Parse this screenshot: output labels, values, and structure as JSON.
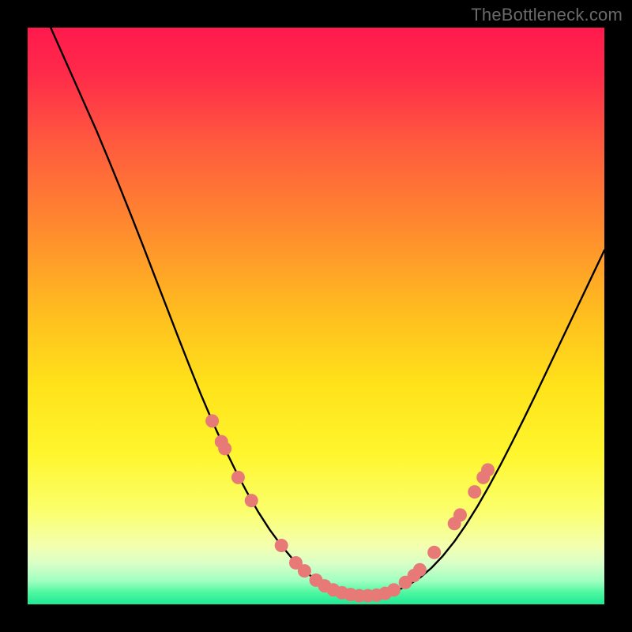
{
  "watermark": "TheBottleneck.com",
  "colors": {
    "curve_stroke": "#000000",
    "dot_fill": "#e77a77",
    "dot_stroke_alpha": 0.0
  },
  "chart_data": {
    "type": "line",
    "title": "",
    "xlabel": "",
    "ylabel": "",
    "xlim": [
      0,
      100
    ],
    "ylim": [
      0,
      100
    ],
    "series": [
      {
        "name": "bottleneck-curve",
        "x": [
          4,
          6,
          8,
          10,
          12,
          14,
          16,
          18,
          20,
          22,
          24,
          26,
          28,
          30,
          32,
          34,
          36,
          38,
          40,
          42,
          44,
          46,
          48,
          50,
          52,
          54,
          56,
          58,
          60,
          62,
          64,
          66,
          68,
          70,
          72,
          74,
          76,
          78,
          80,
          82,
          84,
          86,
          88,
          90,
          92,
          94,
          96,
          98,
          100
        ],
        "y": [
          100,
          95.5,
          91,
          86.5,
          82,
          77.2,
          72.3,
          67.3,
          62.2,
          57,
          51.8,
          46.6,
          41.5,
          36.5,
          31.8,
          27.4,
          23.3,
          19.5,
          16.0,
          12.9,
          10.2,
          7.8,
          5.8,
          4.2,
          3.0,
          2.2,
          1.7,
          1.5,
          1.5,
          1.8,
          2.4,
          3.3,
          4.6,
          6.3,
          8.4,
          10.9,
          13.8,
          17.0,
          20.5,
          24.2,
          28.1,
          32.1,
          36.2,
          40.4,
          44.6,
          48.8,
          53.0,
          57.2,
          61.4
        ]
      }
    ],
    "markers": [
      {
        "x": 32.0,
        "y": 31.8
      },
      {
        "x": 33.6,
        "y": 28.2
      },
      {
        "x": 34.2,
        "y": 27.0
      },
      {
        "x": 36.5,
        "y": 22.0
      },
      {
        "x": 38.8,
        "y": 18.0
      },
      {
        "x": 44.0,
        "y": 10.2
      },
      {
        "x": 46.5,
        "y": 7.2
      },
      {
        "x": 48.0,
        "y": 5.8
      },
      {
        "x": 50.0,
        "y": 4.2
      },
      {
        "x": 51.5,
        "y": 3.2
      },
      {
        "x": 53.0,
        "y": 2.5
      },
      {
        "x": 54.5,
        "y": 2.0
      },
      {
        "x": 56.0,
        "y": 1.7
      },
      {
        "x": 57.5,
        "y": 1.5
      },
      {
        "x": 59.0,
        "y": 1.5
      },
      {
        "x": 60.5,
        "y": 1.6
      },
      {
        "x": 62.0,
        "y": 1.9
      },
      {
        "x": 63.5,
        "y": 2.5
      },
      {
        "x": 65.5,
        "y": 3.8
      },
      {
        "x": 67.0,
        "y": 5.0
      },
      {
        "x": 68.0,
        "y": 6.0
      },
      {
        "x": 70.5,
        "y": 9.0
      },
      {
        "x": 74.0,
        "y": 14.0
      },
      {
        "x": 75.0,
        "y": 15.5
      },
      {
        "x": 77.5,
        "y": 19.5
      },
      {
        "x": 79.0,
        "y": 22.0
      },
      {
        "x": 79.8,
        "y": 23.3
      }
    ]
  }
}
